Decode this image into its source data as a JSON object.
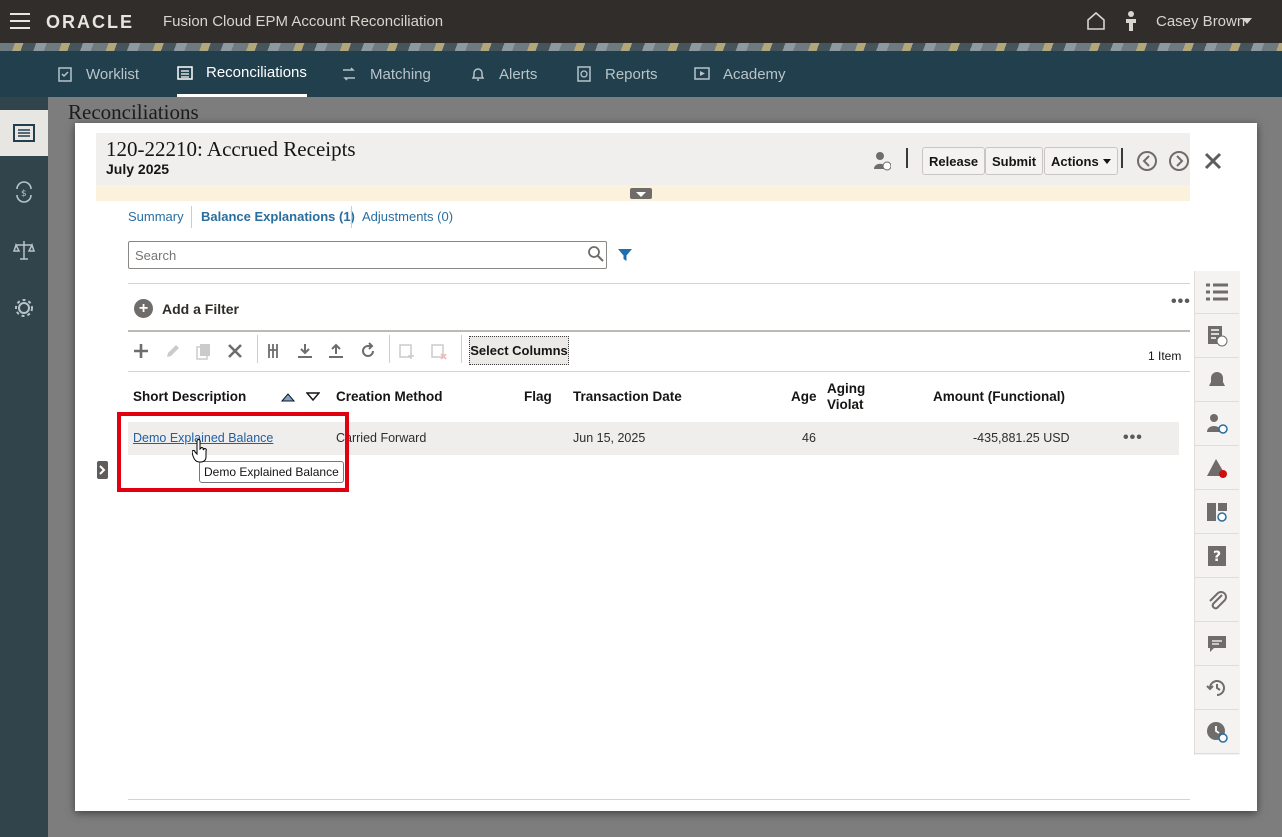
{
  "app": {
    "brand": "ORACLE",
    "product": "Fusion Cloud EPM Account Reconciliation",
    "user": "Casey Brown"
  },
  "nav": {
    "tabs": [
      {
        "label": "Worklist",
        "icon": "clipboard-icon"
      },
      {
        "label": "Reconciliations",
        "icon": "table-list-icon",
        "active": true
      },
      {
        "label": "Matching",
        "icon": "matching-icon"
      },
      {
        "label": "Alerts",
        "icon": "bell-icon"
      },
      {
        "label": "Reports",
        "icon": "report-icon"
      },
      {
        "label": "Academy",
        "icon": "play-icon"
      }
    ]
  },
  "page": {
    "title": "Reconciliations"
  },
  "dialog": {
    "title": "120-22210: Accrued Receipts",
    "period": "July 2025",
    "release_label": "Release",
    "submit_label": "Submit",
    "actions_label": "Actions",
    "subtabs": {
      "summary": "Summary",
      "balance_explanations": "Balance Explanations (1)",
      "adjustments": "Adjustments (0)"
    },
    "search_placeholder": "Search",
    "add_filter_label": "Add a Filter",
    "select_columns_label": "Select Columns",
    "item_count": "1 Item",
    "columns": {
      "short_description": "Short Description",
      "creation_method": "Creation Method",
      "flag": "Flag",
      "transaction_date": "Transaction Date",
      "age": "Age",
      "aging_violation": "Aging Violat",
      "aging_violation_line1": "Aging",
      "aging_violation_line2": "Violat",
      "amount": "Amount (Functional)"
    },
    "rows": [
      {
        "short_description": "Demo Explained Balance",
        "creation_method": "Carried Forward",
        "flag": "",
        "transaction_date": "Jun 15, 2025",
        "age": "46",
        "aging_violation": "",
        "amount": "-435,881.25 USD"
      }
    ],
    "tooltip": "Demo Explained Balance"
  },
  "colors": {
    "header_bg": "#312d2a",
    "nav_bg": "#213f4c",
    "link": "#1f5fa4",
    "highlight": "#e1000f",
    "info_band": "#fcf1dc"
  }
}
